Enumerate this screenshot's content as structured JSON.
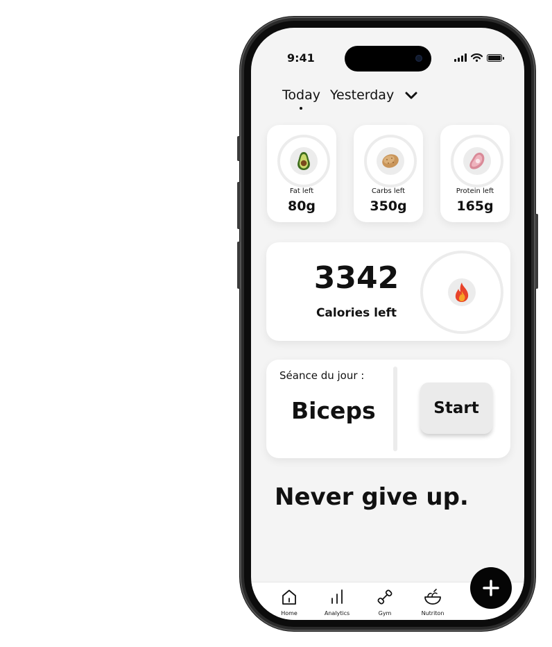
{
  "status": {
    "time": "9:41"
  },
  "tabs": {
    "today": "Today",
    "yesterday": "Yesterday"
  },
  "macros": [
    {
      "label": "Fat left",
      "value": "80g",
      "icon": "avocado-icon"
    },
    {
      "label": "Carbs left",
      "value": "350g",
      "icon": "potato-icon"
    },
    {
      "label": "Protein left",
      "value": "165g",
      "icon": "meat-icon"
    }
  ],
  "calories": {
    "value": "3342",
    "label": "Calories left",
    "icon": "fire-icon"
  },
  "seance": {
    "label": "Séance du jour :",
    "name": "Biceps",
    "start_label": "Start"
  },
  "quote": "Never give up.",
  "nav": [
    {
      "label": "Home",
      "icon": "home-icon"
    },
    {
      "label": "Analytics",
      "icon": "analytics-icon"
    },
    {
      "label": "Gym",
      "icon": "dumbbell-icon"
    },
    {
      "label": "Nutriton",
      "icon": "salad-bowl-icon"
    }
  ],
  "colors": {
    "background": "#f4f4f4",
    "card": "#ffffff",
    "accent": "#050505",
    "ring": "#ececec"
  }
}
